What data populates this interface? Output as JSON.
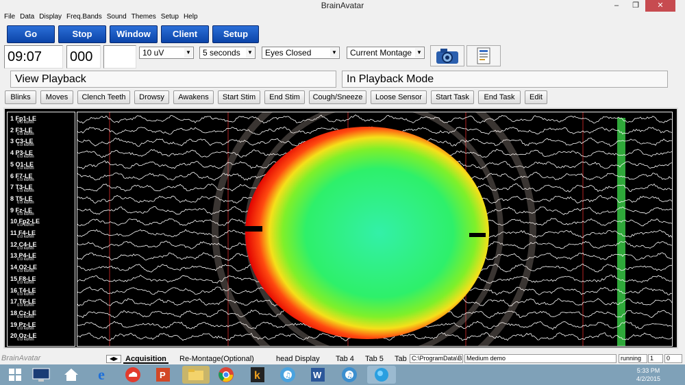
{
  "window": {
    "title": "BrainAvatar"
  },
  "menu": [
    "File",
    "Data",
    "Display",
    "Freq.Bands",
    "Sound",
    "Themes",
    "Setup",
    "Help"
  ],
  "toolbar": {
    "go": "Go",
    "stop": "Stop",
    "window": "Window",
    "client": "Client",
    "setup": "Setup"
  },
  "controls": {
    "time": "09:07",
    "counter": "000",
    "gain": "10 uV",
    "timebase": "5 seconds",
    "condition": "Eyes Closed",
    "montage": "Current Montage"
  },
  "status": {
    "left": "View Playback",
    "right": "In Playback Mode"
  },
  "events": [
    "Blinks",
    "Moves",
    "Clench Teeth",
    "Drowsy",
    "Awakens",
    "Start Stim",
    "End Stim",
    "Cough/Sneeze",
    "Loose Sensor",
    "Start Task",
    "End Task",
    "Edit"
  ],
  "channels": [
    {
      "name": "1 Fp1-LE",
      "imp": "0.0 kohm"
    },
    {
      "name": "2 F3-LE",
      "imp": "0.0 kohm"
    },
    {
      "name": "3 C3-LE",
      "imp": "0.0 kohm"
    },
    {
      "name": "4 P3-LE",
      "imp": "0.0 kohm"
    },
    {
      "name": "5 O1-LE",
      "imp": "0.0 kohm"
    },
    {
      "name": "6 F7-LE",
      "imp": "0.0 kohm"
    },
    {
      "name": "7 T3-LE",
      "imp": "0.0 kohm"
    },
    {
      "name": "8 T5-LE",
      "imp": "0.0 kohm"
    },
    {
      "name": "9 Fz-LE",
      "imp": "0.0 kohm"
    },
    {
      "name": "10 Fp2-LE",
      "imp": "0.0 kohm"
    },
    {
      "name": "11 F4-LE",
      "imp": "0.0 kohm"
    },
    {
      "name": "12 C4-LE",
      "imp": "0.0 kohm"
    },
    {
      "name": "13 P4-LE",
      "imp": "0.0 kohm"
    },
    {
      "name": "14 O2-LE",
      "imp": "0.0 kohm"
    },
    {
      "name": "15 F8-LE",
      "imp": "0.0 kohm"
    },
    {
      "name": "16 T4-LE",
      "imp": "0.0 kohm"
    },
    {
      "name": "17 T6-LE",
      "imp": "0.0 kohm"
    },
    {
      "name": "18 Cz-LE",
      "imp": "0.0 kohm"
    },
    {
      "name": "19 Pz-LE",
      "imp": "0.0 kohm"
    },
    {
      "name": "20 Oz-LE",
      "imp": "0.0 kohm"
    }
  ],
  "watermark": "BrainAvatar",
  "tabs": [
    "Acquisition",
    "Re-Montage(Optional)",
    "head Display",
    "Tab 4",
    "Tab 5",
    "Tab"
  ],
  "statusbar": {
    "path": "C:\\ProgramData\\Br",
    "demo": "Medium demo",
    "state": "running",
    "n1": "1",
    "n2": "0"
  },
  "taskbar": {
    "time": "5:33 PM",
    "date": "4/2/2015"
  },
  "colors": {
    "button_blue": "#1856c2",
    "trace": "#ffffff",
    "marker": "#ff3333",
    "highlight": "#2fa83a"
  }
}
